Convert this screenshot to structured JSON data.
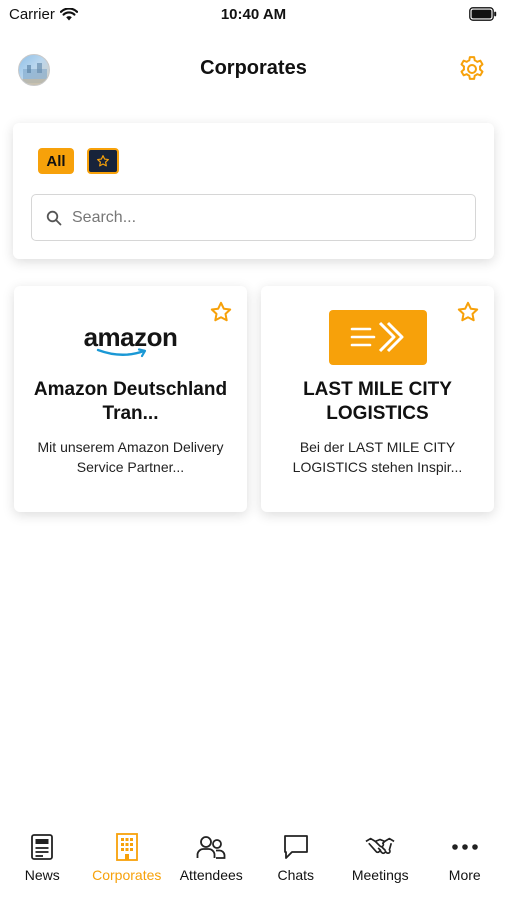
{
  "status_bar": {
    "carrier": "Carrier",
    "time": "10:40 AM"
  },
  "header": {
    "title": "Corporates",
    "settings_icon": "gear-icon",
    "avatar": "user-avatar"
  },
  "filters": {
    "all_label": "All",
    "favorites_icon": "star-icon",
    "search_placeholder": "Search...",
    "search_value": ""
  },
  "corporates": [
    {
      "logo_text": "amazon",
      "name": "Amazon Deutschland Tran...",
      "description": "Mit unserem Amazon Delivery Service Partner...",
      "favorite": false
    },
    {
      "logo_icon": "fast-forward-arrow-logo",
      "name": "LAST MILE CITY LOGISTICS",
      "description": "Bei der LAST MILE CITY LOGISTICS stehen Inspir...",
      "favorite": false
    }
  ],
  "tabs": [
    {
      "label": "News",
      "icon": "newspaper-icon",
      "active": false
    },
    {
      "label": "Corporates",
      "icon": "building-icon",
      "active": true
    },
    {
      "label": "Attendees",
      "icon": "people-icon",
      "active": false
    },
    {
      "label": "Chats",
      "icon": "chat-bubble-icon",
      "active": false
    },
    {
      "label": "Meetings",
      "icon": "handshake-icon",
      "active": false
    },
    {
      "label": "More",
      "icon": "more-dots-icon",
      "active": false
    }
  ],
  "colors": {
    "accent": "#f7a10a",
    "dark_chip": "#17233a",
    "text": "#111111"
  }
}
